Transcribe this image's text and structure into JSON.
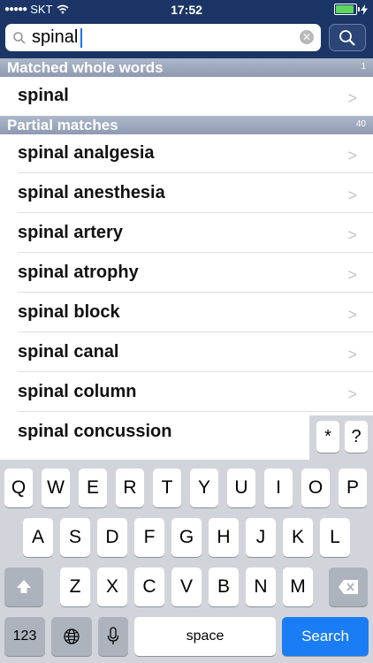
{
  "status_bar": {
    "carrier": "SKT",
    "time": "17:52",
    "battery_level": 0.9
  },
  "search": {
    "query": "spinal",
    "button_icon": "magnifier-icon"
  },
  "sections": [
    {
      "title": "Matched whole words",
      "count": "1",
      "items": [
        "spinal"
      ]
    },
    {
      "title": "Partial matches",
      "count": "40",
      "items": [
        "spinal analgesia",
        "spinal anesthesia",
        "spinal artery",
        "spinal atrophy",
        "spinal block",
        "spinal canal",
        "spinal column",
        "spinal concussion"
      ]
    }
  ],
  "wildcards": {
    "asterisk": "*",
    "question": "?"
  },
  "keyboard": {
    "row1": [
      "Q",
      "W",
      "E",
      "R",
      "T",
      "Y",
      "U",
      "I",
      "O",
      "P"
    ],
    "row2": [
      "A",
      "S",
      "D",
      "F",
      "G",
      "H",
      "J",
      "K",
      "L"
    ],
    "row3": [
      "Z",
      "X",
      "C",
      "V",
      "B",
      "N",
      "M"
    ],
    "numbers_label": "123",
    "space_label": "space",
    "search_label": "Search"
  }
}
